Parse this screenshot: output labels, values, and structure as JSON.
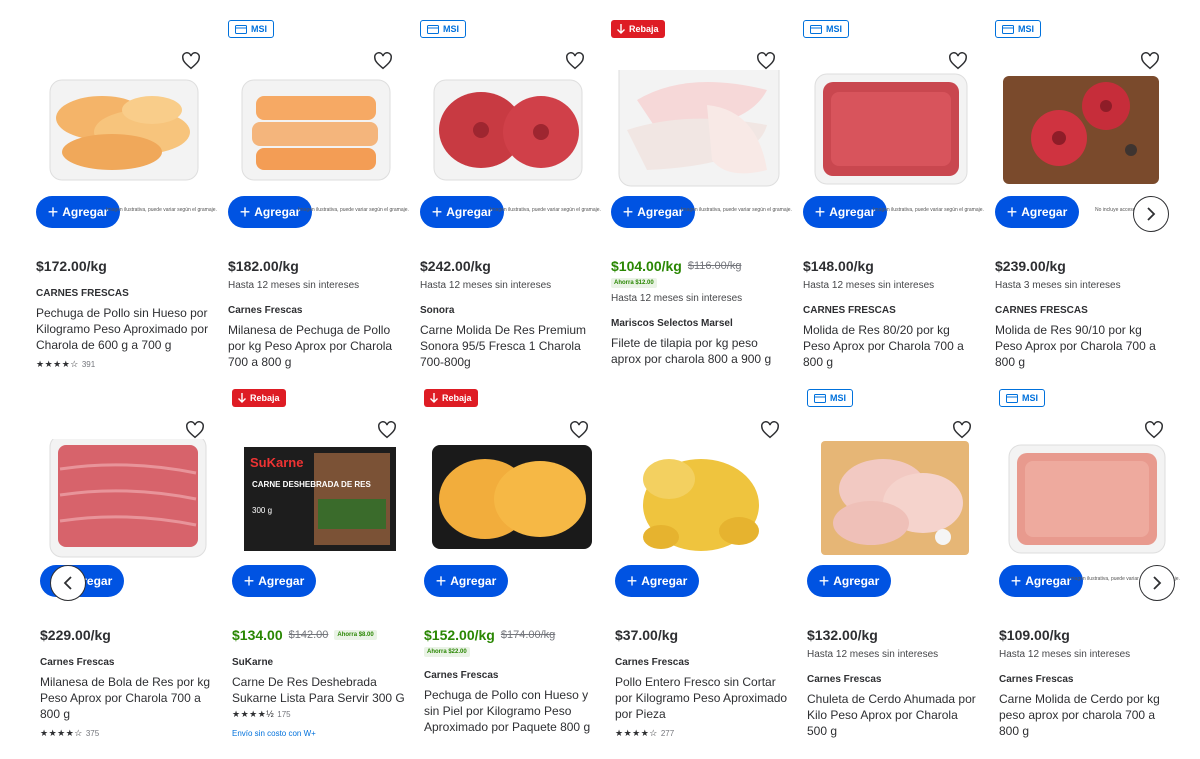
{
  "common": {
    "add_label": "Agregar",
    "msi_badge": "MSI",
    "rebaja_badge": "Rebaja",
    "disclaimer": "Imagen ilustrativa, puede variar según el gramaje."
  },
  "colors": {
    "primary": "#0053e2",
    "sale_green": "#2a8703",
    "rebaja_red": "#de1c24",
    "msi_blue": "#0071dc"
  },
  "icons": {
    "favorite": "heart-outline-icon",
    "add": "plus-icon",
    "next": "chevron-right-icon",
    "prev": "chevron-left-icon",
    "msi": "credit-card-icon",
    "rebaja": "arrow-down-icon"
  },
  "row1": [
    {
      "badge": "",
      "price": "$172.00/kg",
      "msi": "",
      "brand": "CARNES FRESCAS",
      "title": "Pechuga de Pollo sin Hueso por Kilogramo Peso Aproximado por Charola de 600 g a 700 g",
      "rating": 4,
      "reviews": "391"
    },
    {
      "badge": "MSI",
      "price": "$182.00/kg",
      "msi": "Hasta 12 meses sin intereses",
      "brand": "Carnes Frescas",
      "title": "Milanesa de Pechuga de Pollo por kg Peso Aprox por Charola 700 a 800 g"
    },
    {
      "badge": "MSI",
      "price": "$242.00/kg",
      "msi": "Hasta 12 meses sin intereses",
      "brand": "Sonora",
      "title": "Carne Molida De Res Premium Sonora 95/5 Fresca 1 Charola 700-800g"
    },
    {
      "badge": "Rebaja",
      "price": "$104.00/kg",
      "was": "$116.00/kg",
      "savings": "Ahorra $12.00",
      "msi": "Hasta 12 meses sin intereses",
      "brand": "Mariscos Selectos Marsel",
      "title": "Filete de tilapia por kg peso aprox por charola 800 a 900 g"
    },
    {
      "badge": "MSI",
      "price": "$148.00/kg",
      "msi": "Hasta 12 meses sin intereses",
      "brand": "CARNES FRESCAS",
      "title": "Molida de Res 80/20 por kg Peso Aprox por Charola 700 a 800 g"
    },
    {
      "badge": "MSI",
      "price": "$239.00/kg",
      "msi": "Hasta 3 meses sin intereses",
      "brand": "CARNES FRESCAS",
      "title": "Molida de Res 90/10 por kg Peso Aprox por Charola 700 a 800 g",
      "disclaimer": "No incluye accesorios."
    }
  ],
  "row2": [
    {
      "badge": "",
      "price": "$229.00/kg",
      "msi": "",
      "brand": "Carnes Frescas",
      "title": "Milanesa de Bola de Res por kg Peso Aprox por Charola 700 a 800 g",
      "rating": 4,
      "reviews": "375"
    },
    {
      "badge": "Rebaja",
      "price": "$134.00",
      "was": "$142.00",
      "savings": "Ahorra $8.00",
      "brand": "SuKarne",
      "title": "Carne De Res Deshebrada Sukarne Lista Para Servir 300 G",
      "rating": 4.5,
      "reviews": "175",
      "shipping": "Envío sin costo con W+",
      "package_brand": "SuKarne",
      "package_title": "CARNE DESHEBRADA DE RES",
      "package_weight": "300 g"
    },
    {
      "badge": "Rebaja",
      "price": "$152.00/kg",
      "was": "$174.00/kg",
      "savings": "Ahorra $22.00",
      "brand": "Carnes Frescas",
      "title": "Pechuga de Pollo con Hueso y sin Piel por Kilogramo Peso Aproximado por Paquete 800 g"
    },
    {
      "badge": "",
      "price": "$37.00/kg",
      "msi": "",
      "brand": "Carnes Frescas",
      "title": "Pollo Entero Fresco sin Cortar por Kilogramo Peso Aproximado por Pieza",
      "rating": 4,
      "reviews": "277"
    },
    {
      "badge": "MSI",
      "price": "$132.00/kg",
      "msi": "Hasta 12 meses sin intereses",
      "brand": "Carnes Frescas",
      "title": "Chuleta de Cerdo Ahumada por Kilo Peso Aprox por Charola 500 g"
    },
    {
      "badge": "MSI",
      "price": "$109.00/kg",
      "msi": "Hasta 12 meses sin intereses",
      "brand": "Carnes Frescas",
      "title": "Carne Molida de Cerdo por kg peso aprox por charola 700 a 800 g"
    }
  ]
}
